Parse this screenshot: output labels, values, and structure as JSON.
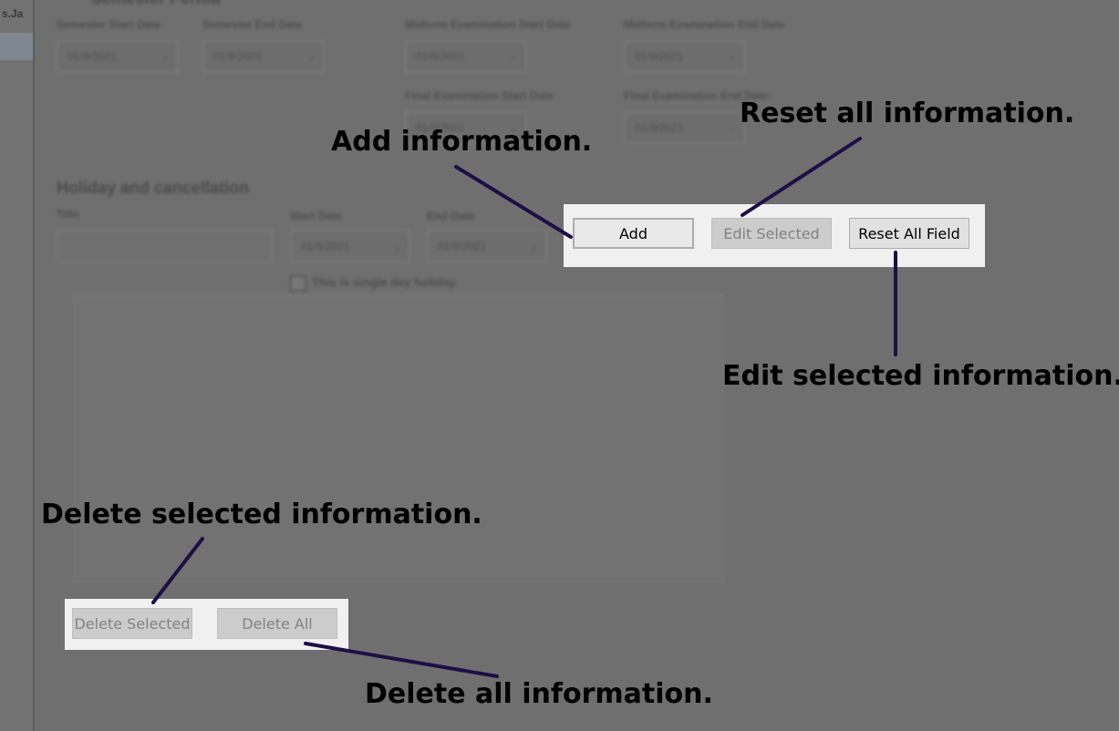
{
  "sidebar": {
    "tab_fragment": "s.Ja"
  },
  "semester_period": {
    "heading": "Semester Period",
    "fields": [
      {
        "label": "Semester Start Date",
        "value": "01/9/2021"
      },
      {
        "label": "Semester End Date",
        "value": "01/9/2021"
      },
      {
        "label": "Midterm Examination Start Date",
        "value": "01/9/2021"
      },
      {
        "label": "Midterm Examination End Date",
        "value": "01/9/2021"
      },
      {
        "label": "Final Examination Start Date",
        "value": "01/9/2021"
      },
      {
        "label": "Final Examination End Date",
        "value": "01/9/2021"
      }
    ]
  },
  "holiday": {
    "heading": "Holiday and cancellation",
    "title_label": "Title",
    "start_label": "Start Date",
    "start_value": "01/9/2021",
    "end_label": "End Date",
    "end_value": "01/9/2021",
    "single_day_label": "This is single day holiday."
  },
  "buttons": {
    "add": "Add",
    "edit_selected": "Edit Selected",
    "reset_all": "Reset All Field",
    "delete_selected": "Delete Selected",
    "delete_all": "Delete All"
  },
  "annotations": {
    "add": "Add information.",
    "reset": "Reset all information.",
    "edit": "Edit selected information.",
    "delete_selected": "Delete selected information.",
    "delete_all": "Delete all information."
  },
  "colors": {
    "overlay_bg": "#6f6f6f",
    "highlight_bg": "#f0f0f0",
    "arrow": "#1c0f45"
  }
}
